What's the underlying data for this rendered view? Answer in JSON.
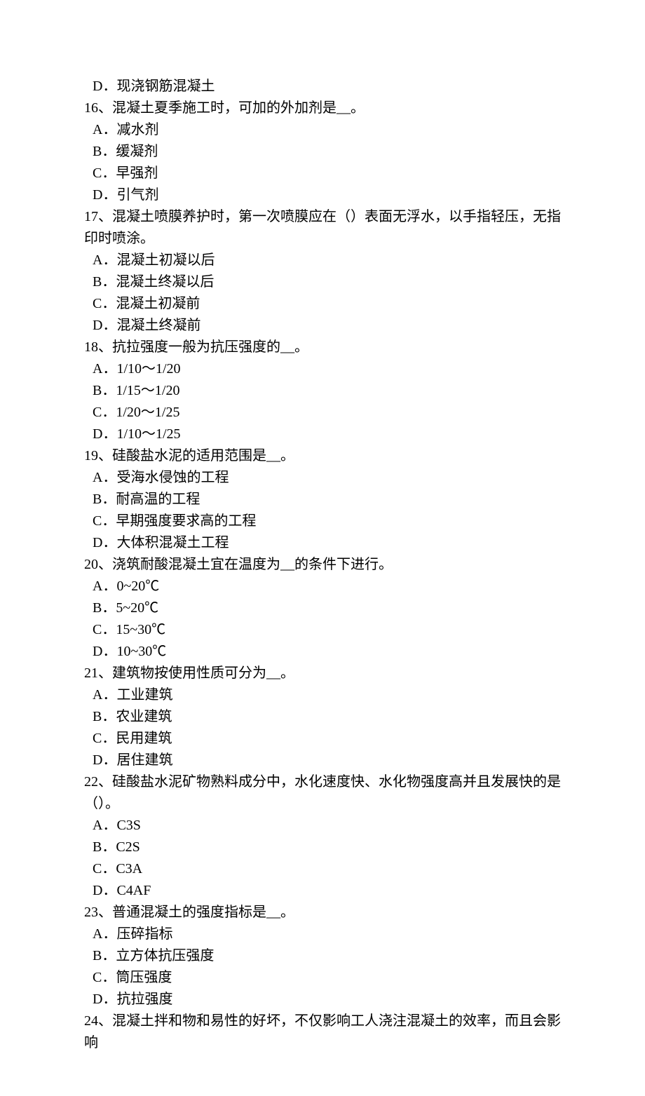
{
  "q15": {
    "optD": "D．现浇钢筋混凝土"
  },
  "q16": {
    "stem": "16、混凝土夏季施工时，可加的外加剂是__。",
    "optA": "A．减水剂",
    "optB": "B．缓凝剂",
    "optC": "C．早强剂",
    "optD": "D．引气剂"
  },
  "q17": {
    "stem": "17、混凝土喷膜养护时，第一次喷膜应在（）表面无浮水，以手指轻压，无指印时喷涂。",
    "optA": "A．混凝土初凝以后",
    "optB": "B．混凝土终凝以后",
    "optC": "C．混凝土初凝前",
    "optD": "D．混凝土终凝前"
  },
  "q18": {
    "stem": "18、抗拉强度一般为抗压强度的__。",
    "optA": "A．1/10～1/20",
    "optB": "B．1/15～1/20",
    "optC": "C．1/20～1/25",
    "optD": "D．1/10～1/25"
  },
  "q19": {
    "stem": "19、硅酸盐水泥的适用范围是__。",
    "optA": "A．受海水侵蚀的工程",
    "optB": "B．耐高温的工程",
    "optC": "C．早期强度要求高的工程",
    "optD": "D．大体积混凝土工程"
  },
  "q20": {
    "stem": "20、浇筑耐酸混凝土宜在温度为__的条件下进行。",
    "optA": "A．0~20℃",
    "optB": "B．5~20℃",
    "optC": "C．15~30℃",
    "optD": "D．10~30℃"
  },
  "q21": {
    "stem": "21、建筑物按使用性质可分为__。",
    "optA": "A．工业建筑",
    "optB": "B．农业建筑",
    "optC": "C．民用建筑",
    "optD": "D．居住建筑"
  },
  "q22": {
    "stem": "22、硅酸盐水泥矿物熟料成分中，水化速度快、水化物强度高并且发展快的是（）。",
    "optA": "A．C3S",
    "optB": "B．C2S",
    "optC": "C．C3A",
    "optD": "D．C4AF"
  },
  "q23": {
    "stem": "23、普通混凝土的强度指标是__。",
    "optA": "A．压碎指标",
    "optB": "B．立方体抗压强度",
    "optC": "C．筒压强度",
    "optD": "D．抗拉强度"
  },
  "q24": {
    "stem": "24、混凝土拌和物和易性的好坏，不仅影响工人浇注混凝土的效率，而且会影响"
  }
}
